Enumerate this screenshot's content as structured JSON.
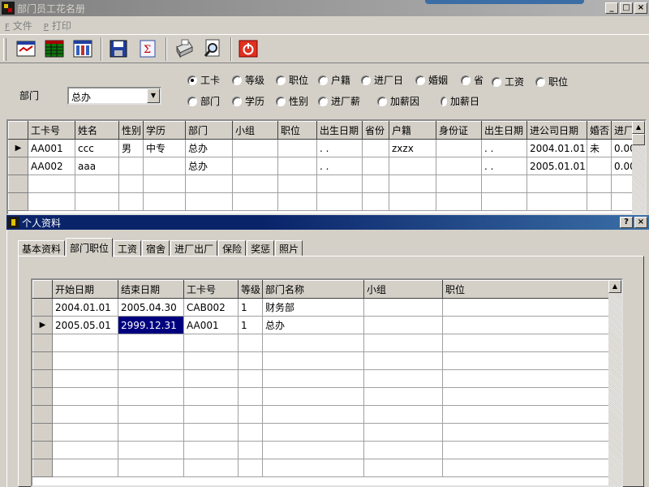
{
  "window": {
    "title": "部门员工花名册"
  },
  "menu": [
    {
      "accel": "F",
      "label": "文件"
    },
    {
      "accel": "P",
      "label": "打印"
    }
  ],
  "toolbar": {
    "buttons": [
      "report-icon",
      "grid-icon",
      "columns-icon",
      "save-icon",
      "sum-icon",
      "printer-icon",
      "preview-icon",
      "power-icon"
    ]
  },
  "filter": {
    "dept_label": "部门",
    "dept_value": "总办",
    "options": [
      "工卡",
      "等级",
      "职位",
      "户籍",
      "进厂日",
      "婚姻",
      "省",
      "工资",
      "职位",
      "部门",
      "学历",
      "性别",
      "进厂薪",
      "加薪因",
      "加薪日"
    ],
    "selected": "工卡"
  },
  "main_grid": {
    "columns": [
      "工卡号",
      "姓名",
      "性别",
      "学历",
      "部门",
      "小组",
      "职位",
      "出生日期",
      "省份",
      "户籍",
      "身份证",
      "出生日期",
      "进公司日期",
      "婚否",
      "进厂"
    ],
    "rows": [
      [
        "AA001",
        "ccc",
        "男",
        "中专",
        "总办",
        "",
        "",
        " . .",
        "",
        "zxzx",
        "",
        " . .",
        "2004.01.01",
        "未",
        "0.00"
      ],
      [
        "AA002",
        "aaa",
        "",
        "",
        "总办",
        "",
        "",
        " . .",
        "",
        "",
        "",
        " . .",
        "2005.01.01",
        "",
        "0.00"
      ]
    ],
    "current_row": 0
  },
  "child_window": {
    "title": "个人资料",
    "tabs": [
      "基本资料",
      "部门职位",
      "工资",
      "宿舍",
      "进厂出厂",
      "保险",
      "奖惩",
      "照片"
    ],
    "active_tab": "部门职位"
  },
  "position_grid": {
    "columns": [
      "开始日期",
      "结束日期",
      "工卡号",
      "等级",
      "部门名称",
      "小组",
      "职位"
    ],
    "rows": [
      [
        "2004.01.01",
        "2005.04.30",
        "CAB002",
        "1",
        "财务部",
        "",
        ""
      ],
      [
        "2005.05.01",
        "2999.12.31",
        "AA001",
        "1",
        "总办",
        "",
        ""
      ]
    ],
    "current_row": 1
  },
  "colors": {
    "selection": "#00007f",
    "active_title": "#0a246a",
    "face": "#d4d0c8"
  }
}
